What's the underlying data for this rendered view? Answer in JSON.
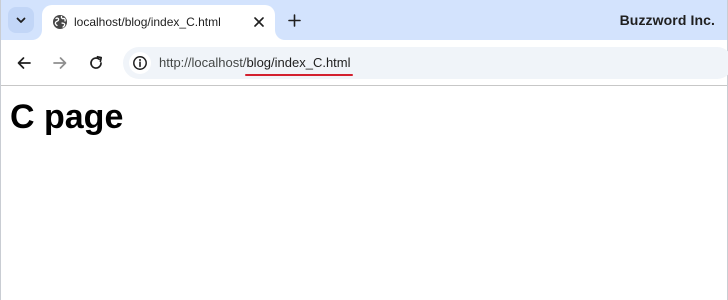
{
  "tab": {
    "title": "localhost/blog/index_C.html",
    "favicon": "globe-icon"
  },
  "brand": {
    "label": "Buzzword Inc."
  },
  "toolbar": {
    "back_icon": "arrow-left-icon",
    "forward_icon": "arrow-right-icon",
    "reload_icon": "reload-icon"
  },
  "address_bar": {
    "origin": "http://localhost/",
    "path": "blog/index_C.html",
    "highlight_color": "#d3202f"
  },
  "page": {
    "heading": "C page"
  },
  "colors": {
    "tabstrip": "#d3e3fd",
    "omnibox": "#f0f4f9",
    "highlight": "#d3202f"
  }
}
